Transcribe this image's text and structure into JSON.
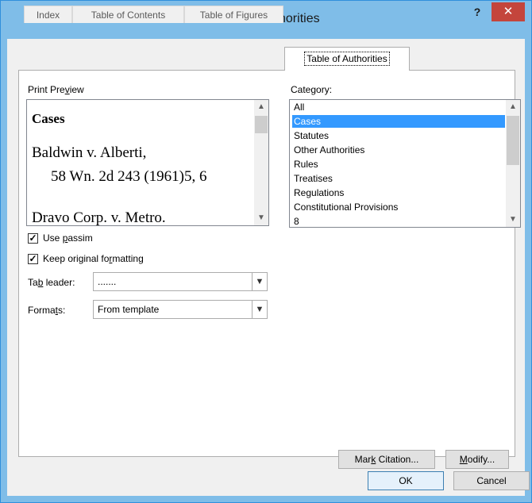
{
  "window": {
    "title": "Table of Authorities",
    "help_glyph": "?",
    "close_glyph": "✕"
  },
  "tabs": [
    {
      "label": "Index",
      "active": false
    },
    {
      "label": "Table of Contents",
      "active": false
    },
    {
      "label": "Table of Figures",
      "active": false
    },
    {
      "label": "Table of Authorities",
      "active": true
    }
  ],
  "preview": {
    "label": "Print Preview",
    "heading": "Cases",
    "lines": [
      "Baldwin v. Alberti,",
      "58 Wn. 2d 243 (1961)5, 6",
      "Dravo Corp. v. Metro."
    ]
  },
  "category": {
    "label": "Category:",
    "items": [
      "All",
      "Cases",
      "Statutes",
      "Other Authorities",
      "Rules",
      "Treatises",
      "Regulations",
      "Constitutional Provisions",
      "8"
    ],
    "selected": "Cases"
  },
  "options": {
    "use_passim": {
      "label": "Use passim",
      "checked": true
    },
    "keep_formatting": {
      "label": "Keep original formatting",
      "checked": true
    }
  },
  "tab_leader": {
    "label": "Tab leader:",
    "value": "......."
  },
  "formats": {
    "label": "Formats:",
    "value": "From template"
  },
  "buttons": {
    "mark_citation": "Mark Citation...",
    "modify": "Modify...",
    "ok": "OK",
    "cancel": "Cancel"
  },
  "colors": {
    "titlebar": "#7fbde8",
    "close": "#c4453c",
    "selection": "#3399ff"
  }
}
